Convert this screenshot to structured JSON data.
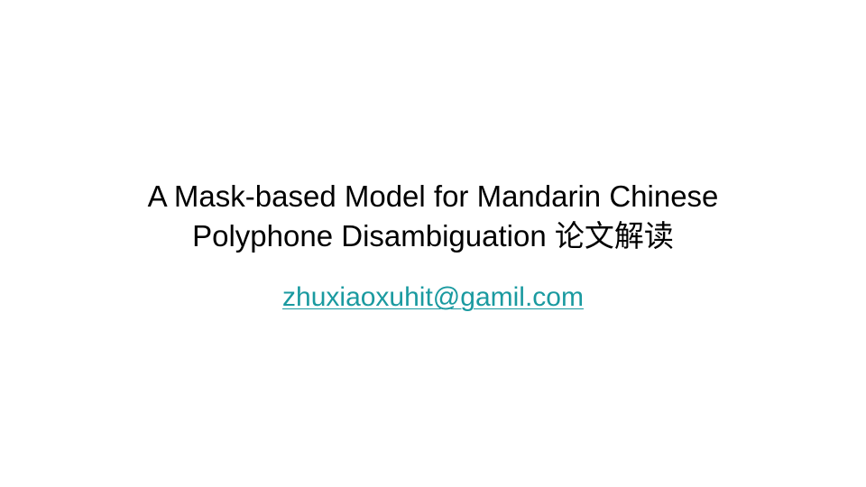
{
  "slide": {
    "title_line_1": "A Mask-based Model for Mandarin Chinese",
    "title_line_2": "Polyphone Disambiguation 论文解读",
    "email": "zhuxiaoxuhit@gamil.com",
    "link_color": "#1a9aa0",
    "background_color": "#ffffff",
    "text_color": "#000000"
  }
}
